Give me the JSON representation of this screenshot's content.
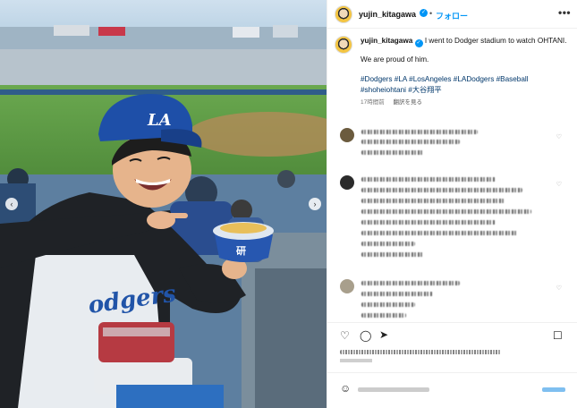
{
  "header": {
    "username": "yujin_kitagawa",
    "separator": "•",
    "follow_label": "フォロー",
    "more_label": "•••"
  },
  "caption": {
    "username": "yujin_kitagawa",
    "text": "I went to Dodger stadium to watch OHTANI.",
    "text2": "We are proud of him.",
    "hashtags": "#Dodgers #LA #LosAngeles #LADodgers #Baseball #shoheiohtani #大谷翔平",
    "time_ago": "17時間前",
    "translate_label": "翻訳を見る"
  },
  "colors": {
    "link": "#0095f6",
    "hashtag": "#00376b",
    "cap_blue": "#1e4fa8"
  },
  "icons": {
    "like": "heart-icon",
    "comment": "comment-icon",
    "share": "share-icon",
    "save": "bookmark-icon",
    "emoji": "emoji-icon"
  }
}
